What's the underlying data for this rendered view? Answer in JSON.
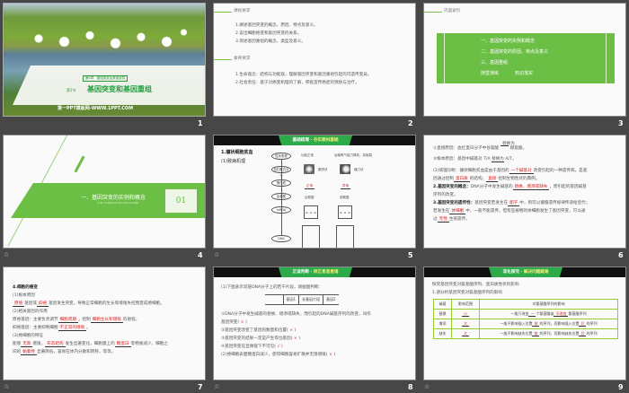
{
  "slides": [
    {
      "number": "1",
      "chapter": "第5章　基因突变及其他变异",
      "section": "第1节",
      "title": "基因突变和基因重组",
      "footer": "第一PPT模板网-WWW.1PPT.COM"
    },
    {
      "number": "2",
      "h1": "课标要求",
      "goals": [
        "1.阐述基因突变的概念、原因、特点及意义。",
        "2.说出细胞癌变和基因突变的关系。",
        "3.简述基因重组的概念、类型及意义。"
      ],
      "h2": "素养要求",
      "literacy": [
        "1.生命观念：结构与功能观，理解基因突变和基因重组引起的可遗传变异。",
        "2.社会责任：基于对癌变机理的了解，积极宣传癌症的预防与治疗。"
      ]
    },
    {
      "number": "3",
      "heading": "内容索引",
      "items": [
        "一、基因突变的实例和概念",
        "二、基因突变的原因、特点及意义",
        "三、基因重组"
      ],
      "practice_a": "随堂演练",
      "practice_b": "知识落实"
    },
    {
      "number": "4",
      "title": "一、基因突变的实例和概念",
      "subtitle": "JI YIN TU BIAN DE SHI LI HE GAI NIAN",
      "index": "01"
    },
    {
      "number": "5",
      "banner_a": "基础梳理 · ",
      "banner_b": "夯实教材基础",
      "h": "1.镰状细胞贫血",
      "sub": "(1)致病机理",
      "chain": [
        "性状表现",
        "血红蛋白分子",
        "蛋白质",
        "氨基酸",
        "mRNA",
        "DNA"
      ],
      "top_normal": "功能正常",
      "top_abnormal": "运输氧气能力降低，易破裂",
      "shape_normal": "圆饼状",
      "shape_abnormal": "镰刀状",
      "normal": "正常",
      "abnormal": "异常",
      "aa_normal": "谷氨酸",
      "aa_abnormal": "缬氨酸",
      "bases_normal": [
        "G",
        "A",
        "G"
      ],
      "bases_abnormal": [
        "G",
        "U",
        "G"
      ]
    },
    {
      "number": "6",
      "l1a": "①直接原因：血红蛋白分子中谷氨酸",
      "l1b": "替换为",
      "l1c": "缬氨酸。",
      "l2a": "②根本原因：基因中碱基对",
      "l2b": "T/A",
      "l2c": "替换为",
      "l2d": "A/T。",
      "l3a": "(2)病理诊断：镰状细胞贫血是由于基因的",
      "l3r": "一个碱基对",
      "l3b": "改变引起的一种遗传病，是基",
      "l4a": "因通过控制",
      "l4r1": "蛋白质",
      "l4b": "的结构，",
      "l4r2": "直接",
      "l4c": "控制生物性状的典例。",
      "l5h": "2.基因突变的概念：",
      "l5a": "DNA分子中发生碱基的",
      "l5r": "替换、增添或缺失",
      "l5b": "，而引起的基因碱基",
      "l6": "序列的改变。",
      "l7h": "3.基因突变的遗传性：",
      "l7a": "基因突变若发生在",
      "l7r": "配子",
      "l7b": "中，则可以遵循遗传规律传递给后代；",
      "l8a": "若发生在",
      "l8r": "体细胞",
      "l8b": "中，一般不能遗传。但有些植物的体细胞发生了基因突变，可以通",
      "l9a": "过",
      "l9r": "无性",
      "l9b": "生殖遗传。"
    },
    {
      "number": "7",
      "h": "4.细胞的癌变",
      "s1": "(1)根本原因",
      "l1r1": "原癌",
      "l1a": "基因或",
      "l1r2": "抑癌",
      "l1b": "基因发生突变，导致正常细胞的生长和增殖失控而变成癌细胞。",
      "s2": "(2)相关基因的作用",
      "l2a": "原癌基因：主要负责调节",
      "l2r1": "细胞周期",
      "l2b": "，控制",
      "l2r2": "细胞生长和增殖",
      "l2c": "的进程。",
      "l3a": "抑癌基因：主要抑制细胞",
      "l3r": "不正常的增殖",
      "l3b": "。",
      "s3": "(3)癌细胞的特征",
      "l4a": "能够",
      "l4r1": "无限",
      "l4b": "增殖，",
      "l4r2": "形态结构",
      "l4c": "发生显著变化，细胞膜上的",
      "l4r3": "糖蛋白",
      "l4d": "等物质减少，细胞之",
      "l5a": "间的",
      "l5r": "黏着性",
      "l5b": "显著降低，容易在体内分散和转移，等等。"
    },
    {
      "number": "8",
      "banner_a": "正误判断 · ",
      "banner_b": "矫正易混易错",
      "q": "(1)下图表示双链DNA分子上的若干片段，请据图判断：",
      "cols": [
        "基因1",
        "非基因片段",
        "基因2"
      ],
      "items": [
        {
          "text": "①DNA分子中发生碱基的替换、增添或缺失，而引起的DNA碱基序列的改变，叫作",
          "text2": "基因突变(",
          "mark": "×"
        },
        {
          "text": "②基因突变改变了基因的数量和位置(",
          "mark": "×"
        },
        {
          "text": "③基因突变的结果一定是产生等位基因(",
          "mark": "×"
        },
        {
          "text": "④基因突变在显微镜下不可见(",
          "mark": "√"
        },
        {
          "text": "(2)癌细胞表面糖蛋白减少，使得细胞容易扩散并无限增殖(",
          "mark": "×"
        }
      ]
    },
    {
      "number": "9",
      "banner_a": "深化探究 · ",
      "banner_b": "解决问题疑难",
      "intro": "探究基因突变对氨基酸序列、蛋白质性状的影响",
      "q1": "1.请分析基因突变对氨基酸序列的影响",
      "headers": [
        "碱基",
        "影响范围",
        "对氨基酸序列的影响"
      ],
      "rows": [
        {
          "type": "替换",
          "range": "小",
          "a": "一般只改变",
          "r1": "一",
          "b": "个氨基酸或",
          "r2": "不改变",
          "c": "氨基酸序列"
        },
        {
          "type": "增添",
          "range": "大",
          "a": "一般不影响插入位置",
          "r1": "前",
          "b": "的序列，而影响插入位置",
          "r2": "后",
          "c": "的序列"
        },
        {
          "type": "缺失",
          "range": "大",
          "a": "一般不影响缺失位置",
          "r1": "前",
          "b": "的序列，而影响缺失位置",
          "r2": "后",
          "c": "的序列"
        }
      ]
    }
  ],
  "anim_icon": "☆"
}
